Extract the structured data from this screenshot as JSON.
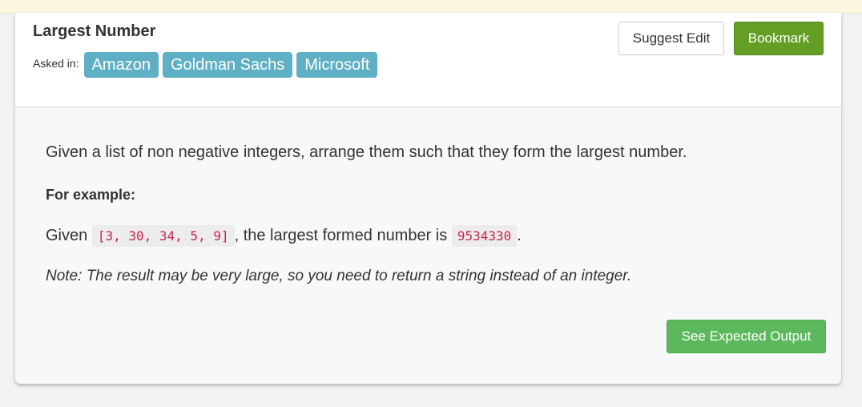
{
  "problem": {
    "title": "Largest Number",
    "asked_in_label": "Asked in:",
    "companies": [
      "Amazon",
      "Goldman Sachs",
      "Microsoft"
    ]
  },
  "actions": {
    "suggest_edit": "Suggest Edit",
    "bookmark": "Bookmark",
    "see_expected_output": "See Expected Output"
  },
  "description": {
    "text": "Given a list of non negative integers, arrange them such that they form the largest number.",
    "example_heading": "For example:",
    "given_prefix": "Given",
    "example_input": "[3, 30, 34, 5, 9]",
    "given_middle": ", the largest formed number is",
    "example_output": "9534330",
    "given_suffix": ".",
    "note": "Note: The result may be very large, so you need to return a string instead of an integer."
  },
  "colors": {
    "tag_bg": "#5fb0c5",
    "bookmark_bg": "#629f24",
    "output_bg": "#5cb85c",
    "code_text": "#c7254e",
    "top_strip": "#fcf6e0"
  }
}
